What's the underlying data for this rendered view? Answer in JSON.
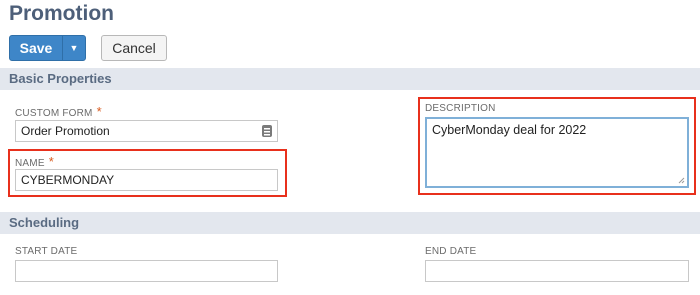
{
  "page": {
    "title": "Promotion"
  },
  "toolbar": {
    "save_label": "Save",
    "cancel_label": "Cancel"
  },
  "sections": {
    "basic": {
      "title": "Basic Properties"
    },
    "scheduling": {
      "title": "Scheduling"
    }
  },
  "fields": {
    "custom_form": {
      "label": "CUSTOM FORM",
      "required": "*",
      "value": "Order Promotion"
    },
    "name": {
      "label": "NAME",
      "required": "*",
      "value": "CYBERMONDAY"
    },
    "description": {
      "label": "DESCRIPTION",
      "value": "CyberMonday deal for 2022"
    },
    "start_date": {
      "label": "START DATE",
      "value": ""
    },
    "end_date": {
      "label": "END DATE",
      "value": ""
    }
  },
  "colors": {
    "accent": "#3e86c8",
    "highlight": "#e8301c",
    "section_bar": "#e3e7ee",
    "required": "#d85a1e"
  },
  "icons": {
    "save_dropdown": "chevron-down-icon",
    "custom_form_select": "list-select-icon",
    "description_resize": "resize-grip-icon"
  }
}
